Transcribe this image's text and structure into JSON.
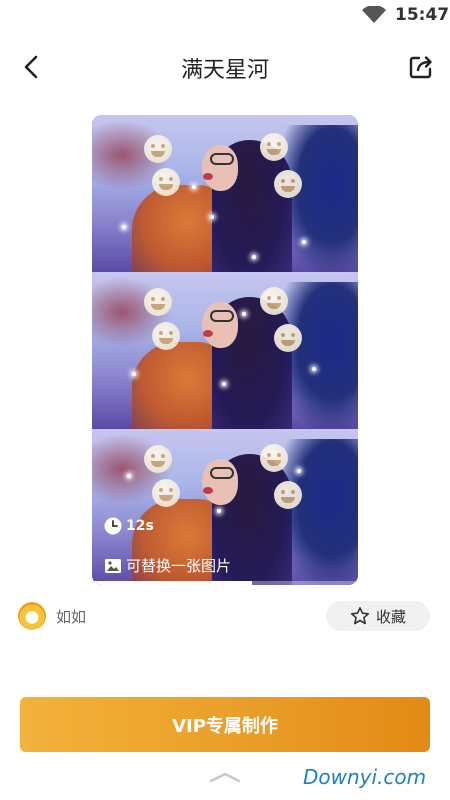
{
  "status_bar": {
    "time": "15:47"
  },
  "header": {
    "title": "满天星河"
  },
  "preview": {
    "duration": "12s",
    "replace_hint": "可替换一张图片",
    "progress": 0.6
  },
  "author": {
    "name": "如如"
  },
  "favorite": {
    "label": "收藏"
  },
  "vip_button": {
    "label": "VIP专属制作"
  },
  "watermark": "Downyi.com",
  "colors": {
    "accent": "#eaa02a",
    "watermark": "#1f7fc6"
  }
}
